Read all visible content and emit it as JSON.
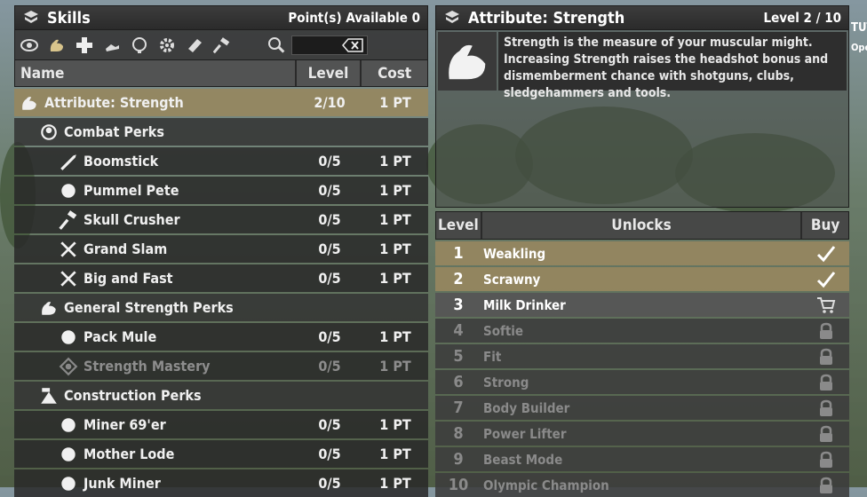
{
  "skills_panel": {
    "title": "Skills",
    "points_label": "Point(s) Available 0",
    "headers": {
      "name": "Name",
      "level": "Level",
      "cost": "Cost"
    },
    "toolbar_icons": [
      "eye-icon",
      "muscle-icon",
      "plus-icon",
      "running-icon",
      "brain-icon",
      "gear-icon",
      "book-icon",
      "hammer-icon",
      "search-icon"
    ],
    "rows": [
      {
        "type": "attr",
        "icon": "muscle-icon",
        "name": "Attribute: Strength",
        "level": "2/10",
        "cost": "1 PT"
      },
      {
        "type": "cat",
        "icon": "combat-icon",
        "name": "Combat Perks",
        "level": "",
        "cost": ""
      },
      {
        "type": "perk",
        "icon": "shotgun-icon",
        "name": "Boomstick",
        "level": "0/5",
        "cost": "1 PT"
      },
      {
        "type": "perk",
        "icon": "fist-icon",
        "name": "Pummel Pete",
        "level": "0/5",
        "cost": "1 PT"
      },
      {
        "type": "perk",
        "icon": "sledgehammer-icon",
        "name": "Skull Crusher",
        "level": "0/5",
        "cost": "1 PT"
      },
      {
        "type": "perk",
        "icon": "crossed-weapons-icon",
        "name": "Grand Slam",
        "level": "0/5",
        "cost": "1 PT"
      },
      {
        "type": "perk",
        "icon": "crossed-tools-icon",
        "name": "Big and Fast",
        "level": "0/5",
        "cost": "1 PT"
      },
      {
        "type": "cat",
        "icon": "muscle-icon",
        "name": "General Strength Perks",
        "level": "",
        "cost": ""
      },
      {
        "type": "perk",
        "icon": "pack-mule-icon",
        "name": "Pack Mule",
        "level": "0/5",
        "cost": "1 PT"
      },
      {
        "type": "perk dim",
        "icon": "mastery-icon",
        "name": "Strength Mastery",
        "level": "0/5",
        "cost": "1 PT"
      },
      {
        "type": "cat",
        "icon": "construction-icon",
        "name": "Construction Perks",
        "level": "",
        "cost": ""
      },
      {
        "type": "perk",
        "icon": "pickaxe-icon",
        "name": "Miner 69'er",
        "level": "0/5",
        "cost": "1 PT"
      },
      {
        "type": "perk",
        "icon": "mother-lode-icon",
        "name": "Mother Lode",
        "level": "0/5",
        "cost": "1 PT"
      },
      {
        "type": "perk",
        "icon": "junk-icon",
        "name": "Junk Miner",
        "level": "0/5",
        "cost": "1 PT"
      }
    ]
  },
  "detail_panel": {
    "title": "Attribute: Strength",
    "level_label": "Level 2 / 10",
    "description": "Strength is the measure of your muscular might. Increasing Strength raises the headshot bonus and dismemberment chance with shotguns, clubs, sledgehammers and tools.",
    "headers": {
      "level": "Level",
      "unlocks": "Unlocks",
      "buy": "Buy"
    },
    "unlocks": [
      {
        "level": "1",
        "name": "Weakling",
        "state": "own"
      },
      {
        "level": "2",
        "name": "Scrawny",
        "state": "own"
      },
      {
        "level": "3",
        "name": "Milk Drinker",
        "state": "next"
      },
      {
        "level": "4",
        "name": "Softie",
        "state": "locked"
      },
      {
        "level": "5",
        "name": "Fit",
        "state": "locked"
      },
      {
        "level": "6",
        "name": "Strong",
        "state": "locked"
      },
      {
        "level": "7",
        "name": "Body Builder",
        "state": "locked"
      },
      {
        "level": "8",
        "name": "Power Lifter",
        "state": "locked"
      },
      {
        "level": "9",
        "name": "Beast Mode",
        "state": "locked"
      },
      {
        "level": "10",
        "name": "Olympic Champion",
        "state": "locked"
      }
    ]
  },
  "edge_text": {
    "right_top": "TUT",
    "right_open": "Open"
  }
}
